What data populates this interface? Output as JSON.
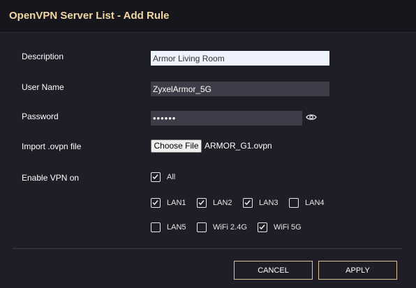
{
  "dialog": {
    "title": "OpenVPN Server List - Add Rule"
  },
  "form": {
    "description": {
      "label": "Description",
      "value": "Armor Living Room"
    },
    "username": {
      "label": "User Name",
      "value": "ZyxelArmor_5G"
    },
    "password": {
      "label": "Password",
      "value": "••••••",
      "reveal_icon": "eye-icon"
    },
    "import_file": {
      "label": "Import .ovpn file",
      "button_label": "Choose File",
      "file_name": "ARMOR_G1.ovpn"
    },
    "enable_vpn": {
      "label": "Enable VPN on",
      "options": [
        {
          "label": "All",
          "checked": true
        },
        {
          "label": "LAN1",
          "checked": true
        },
        {
          "label": "LAN2",
          "checked": true
        },
        {
          "label": "LAN3",
          "checked": true
        },
        {
          "label": "LAN4",
          "checked": false
        },
        {
          "label": "LAN5",
          "checked": false
        },
        {
          "label": "WiFi 2.4G",
          "checked": false
        },
        {
          "label": "WiFi 5G",
          "checked": true
        }
      ]
    }
  },
  "buttons": {
    "cancel_label": "CANCEL",
    "apply_label": "APPLY"
  },
  "colors": {
    "background": "#1f1e26",
    "title_bar": "#17161c",
    "title_text": "#f2d8a0",
    "button_border": "#d9c29a",
    "dark_input": "#3e3c48",
    "light_input": "#eef2fc"
  }
}
